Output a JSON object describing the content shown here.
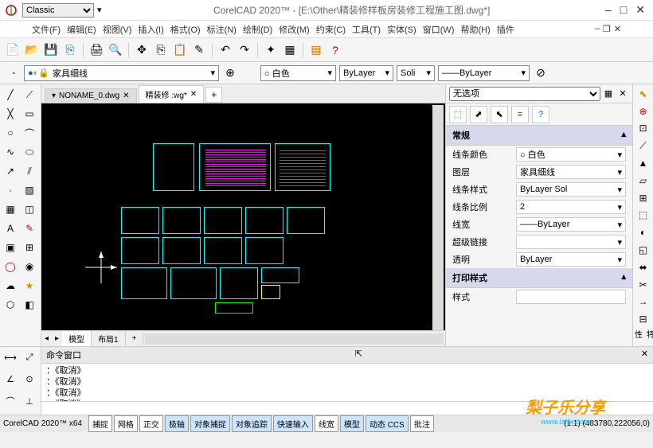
{
  "title": "CorelCAD 2020™ - [E:\\Other\\精装修样板房装修工程施工图.dwg*]",
  "classic": "Classic",
  "menus": [
    "文件(F)",
    "编辑(E)",
    "视图(V)",
    "插入(I)",
    "格式(O)",
    "标注(N)",
    "绘制(D)",
    "修改(M)",
    "约束(C)",
    "工具(T)",
    "实体(S)",
    "窗口(W)",
    "帮助(H)",
    "插件"
  ],
  "layer_current": "家具细线",
  "color_current": "○ 白色",
  "ltype_current": "ByLayer",
  "lstyle_current": "Soli",
  "lweight_current": "——ByLayer",
  "tabs": {
    "inactive": "NONAME_0.dwg",
    "active": "精装修 :wg*",
    "plus": "+"
  },
  "view_tabs": {
    "model": "模型",
    "layout": "布局1",
    "plus": "+"
  },
  "props": {
    "no_sel": "无选项",
    "section1": "常规",
    "rows": [
      {
        "label": "线条颜色",
        "value": "○ 白色"
      },
      {
        "label": "图层",
        "value": "家具细线"
      },
      {
        "label": "线条样式",
        "value": "ByLayer    Sol"
      },
      {
        "label": "线条比例",
        "value": "2"
      },
      {
        "label": "线宽",
        "value": "——ByLayer"
      },
      {
        "label": "超级链接",
        "value": ""
      },
      {
        "label": "透明",
        "value": "ByLayer"
      }
    ],
    "section2": "打印样式",
    "rows2": [
      {
        "label": "样式",
        "value": ""
      }
    ]
  },
  "cmd": {
    "title": "命令窗口",
    "lines": [
      "：《取消》",
      "：《取消》",
      "：《取消》",
      "：《取消》"
    ]
  },
  "status": {
    "app": "CorelCAD 2020™ x64",
    "buttons": [
      "捕捉",
      "网格",
      "正交",
      "极轴",
      "对象捕捉",
      "对象追踪",
      "快速输入",
      "线宽",
      "模型",
      "动态 CCS",
      "批注"
    ],
    "coords": "(1:1) (483780,222056,0)"
  },
  "watermark": {
    "text": "梨子乐分享",
    "url": "www.lzlfx.com"
  }
}
